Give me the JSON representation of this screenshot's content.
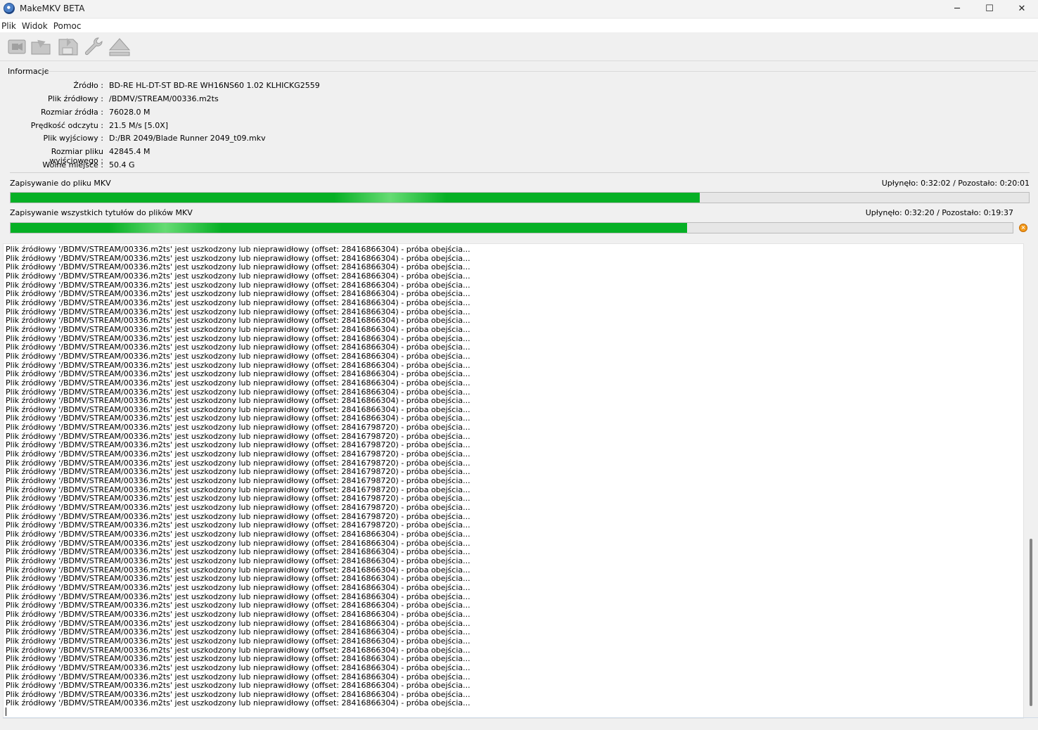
{
  "window": {
    "title": "MakeMKV BETA",
    "minimize": "─",
    "maximize": "☐",
    "close": "✕"
  },
  "menu": [
    "Plik",
    "Widok",
    "Pomoc"
  ],
  "toolbar": {
    "buttons": [
      {
        "icon": "open-video-file-icon"
      },
      {
        "icon": "open-folder-icon"
      },
      {
        "icon": "save-to-disk-icon"
      },
      {
        "icon": "wrench-settings-icon"
      },
      {
        "icon": "eject-icon"
      }
    ]
  },
  "info": {
    "section_label": "Informacje",
    "rows": [
      {
        "label": "Źródło :",
        "value": "BD-RE HL-DT-ST BD-RE  WH16NS60 1.02 KLHICKG2559"
      },
      {
        "label": "Plik źródłowy :",
        "value": "/BDMV/STREAM/00336.m2ts"
      },
      {
        "label": "Rozmiar źródła :",
        "value": "76028.0 M"
      },
      {
        "label": "Prędkość odczytu :",
        "value": "21.5 M/s [5.0X]"
      },
      {
        "label": "Plik wyjściowy :",
        "value": "D:/BR 2049/Blade Runner 2049_t09.mkv"
      },
      {
        "label": "Rozmiar pliku wyjściowego :",
        "value": "42845.4 M"
      },
      {
        "label": "Wolne miejsce :",
        "value": "50.4 G"
      }
    ]
  },
  "progress": [
    {
      "label": "Zapisywanie do pliku MKV",
      "time": "Upłynęło: 0:32:02 / Pozostało: 0:20:01",
      "fraction": 0.677
    },
    {
      "label": "Zapisywanie wszystkich tytułów do plików MKV",
      "time": "Upłynęło: 0:32:20 / Pozostało: 0:19:37",
      "fraction": 0.675
    }
  ],
  "colors": {
    "progress_fill": "#06b025",
    "cancel": "#f39a1a"
  },
  "log": {
    "prefix": "Plik źródłowy '/BDMV/STREAM/00336.m2ts' jest uszkodzony lub nieprawidłowy (offset: ",
    "suffix": ") - próba obejścia...",
    "offsets": [
      "28416866304",
      "28416866304",
      "28416866304",
      "28416866304",
      "28416866304",
      "28416866304",
      "28416866304",
      "28416866304",
      "28416866304",
      "28416866304",
      "28416866304",
      "28416866304",
      "28416866304",
      "28416866304",
      "28416866304",
      "28416866304",
      "28416866304",
      "28416866304",
      "28416866304",
      "28416866304",
      "28416798720",
      "28416798720",
      "28416798720",
      "28416798720",
      "28416798720",
      "28416798720",
      "28416798720",
      "28416798720",
      "28416798720",
      "28416798720",
      "28416798720",
      "28416798720",
      "28416866304",
      "28416866304",
      "28416866304",
      "28416866304",
      "28416866304",
      "28416866304",
      "28416866304",
      "28416866304",
      "28416866304",
      "28416866304",
      "28416866304",
      "28416866304",
      "28416866304",
      "28416866304",
      "28416866304",
      "28416866304",
      "28416866304",
      "28416866304",
      "28416866304",
      "28416866304"
    ]
  }
}
